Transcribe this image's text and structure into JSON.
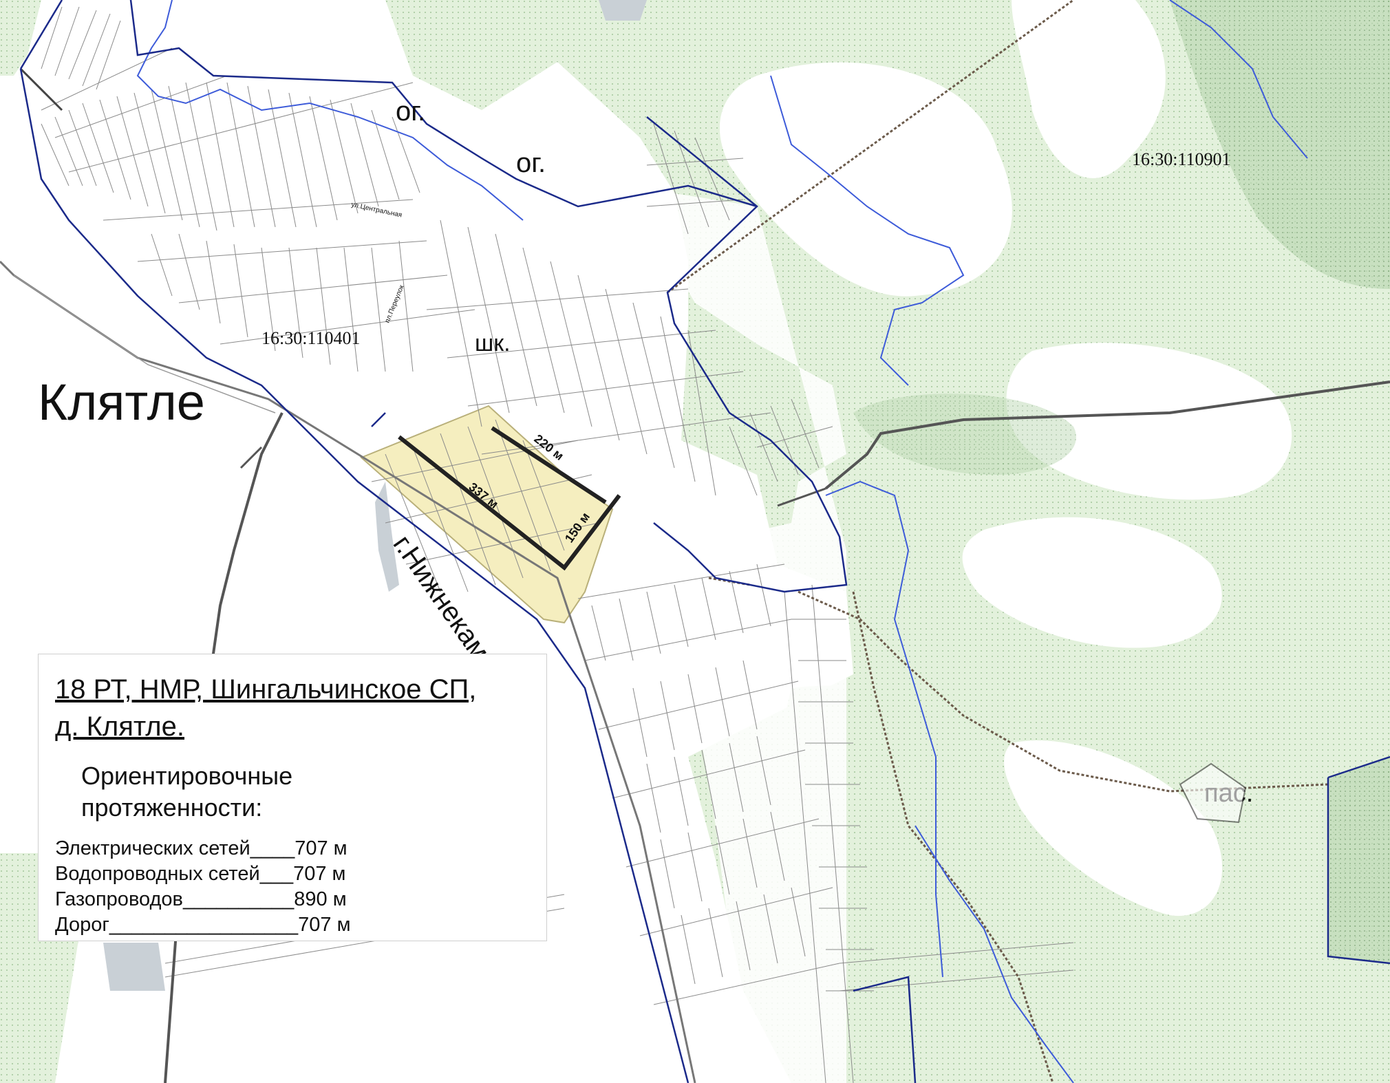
{
  "map": {
    "village_name": "Клятле",
    "cadastral_west": "16:30:110401",
    "cadastral_east": "16:30:110901",
    "labels": {
      "og_1": "ог.",
      "og_2": "ог.",
      "school": "шк.",
      "pasture": "пас.",
      "road": "г.Нижнекамс"
    },
    "streets": {
      "central": "ул.Центральная",
      "lane": "пл.Переулок"
    },
    "measurements": {
      "m220": "220 м",
      "m337": "337 м",
      "m150": "150 м"
    },
    "colors": {
      "green_area": "#e3f1dc",
      "dark_green": "#bcd9b4",
      "highlight_plot": "#f5eebf",
      "water": "#3d5bd9",
      "boundary": "#1b2a8a",
      "road": "#555555",
      "rail": "#6b5a4a"
    }
  },
  "legend": {
    "title_line1": "18 РТ, НМР, Шингальчинское СП,",
    "title_line2": "д. Клятле.",
    "subtitle_line1": "Ориентировочные",
    "subtitle_line2": "протяженности:",
    "rows": [
      {
        "label": "Электрических сетей____",
        "value": "707 м"
      },
      {
        "label": "Водопроводных сетей___",
        "value": "707 м"
      },
      {
        "label": "Газопроводов__________",
        "value": "890 м"
      },
      {
        "label": "Дорог_________________",
        "value": "707 м"
      }
    ]
  }
}
